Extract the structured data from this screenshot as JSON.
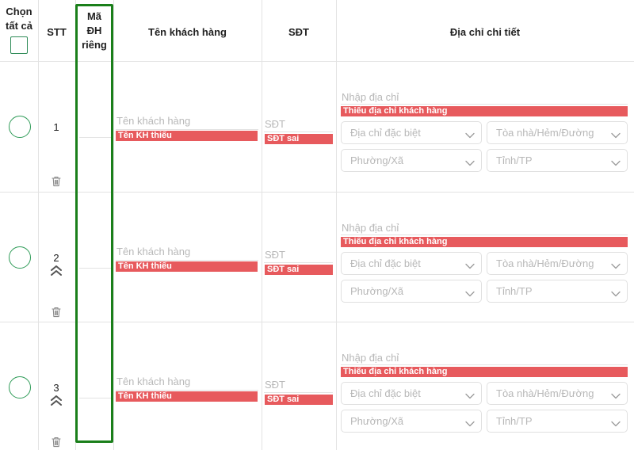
{
  "header": {
    "select_all_line1": "Chọn",
    "select_all_line2": "tất cả",
    "stt": "STT",
    "ma_line1": "Mã",
    "ma_line2": "ĐH",
    "ma_line3": "riêng",
    "customer_name": "Tên khách hàng",
    "phone": "SĐT",
    "address": "Địa chỉ chi tiết"
  },
  "rows": [
    {
      "stt": "1",
      "name_placeholder": "Tên khách hàng",
      "name_error": "Tên KH thiếu",
      "phone_placeholder": "SĐT",
      "phone_error": "SĐT sai",
      "address_placeholder": "Nhập địa chỉ",
      "address_error": "Thiếu địa chỉ khách hàng",
      "special_address": "Địa chỉ đặc biệt",
      "building_street": "Tòa nhà/Hẻm/Đường",
      "ward": "Phường/Xã",
      "province": "Tỉnh/TP",
      "has_move_up": false
    },
    {
      "stt": "2",
      "name_placeholder": "Tên khách hàng",
      "name_error": "Tên KH thiếu",
      "phone_placeholder": "SĐT",
      "phone_error": "SĐT sai",
      "address_placeholder": "Nhập địa chỉ",
      "address_error": "Thiếu địa chỉ khách hàng",
      "special_address": "Địa chỉ đặc biệt",
      "building_street": "Tòa nhà/Hẻm/Đường",
      "ward": "Phường/Xã",
      "province": "Tỉnh/TP",
      "has_move_up": true
    },
    {
      "stt": "3",
      "name_placeholder": "Tên khách hàng",
      "name_error": "Tên KH thiếu",
      "phone_placeholder": "SĐT",
      "phone_error": "SĐT sai",
      "address_placeholder": "Nhập địa chỉ",
      "address_error": "Thiếu địa chỉ khách hàng",
      "special_address": "Địa chỉ đặc biệt",
      "building_street": "Tòa nhà/Hẻm/Đường",
      "ward": "Phường/Xã",
      "province": "Tỉnh/TP",
      "has_move_up": true
    }
  ],
  "colors": {
    "error": "#e75a5d",
    "accent_green": "#2e9b57",
    "highlight_green": "#1a7f1a",
    "placeholder": "#b8b8b8"
  }
}
